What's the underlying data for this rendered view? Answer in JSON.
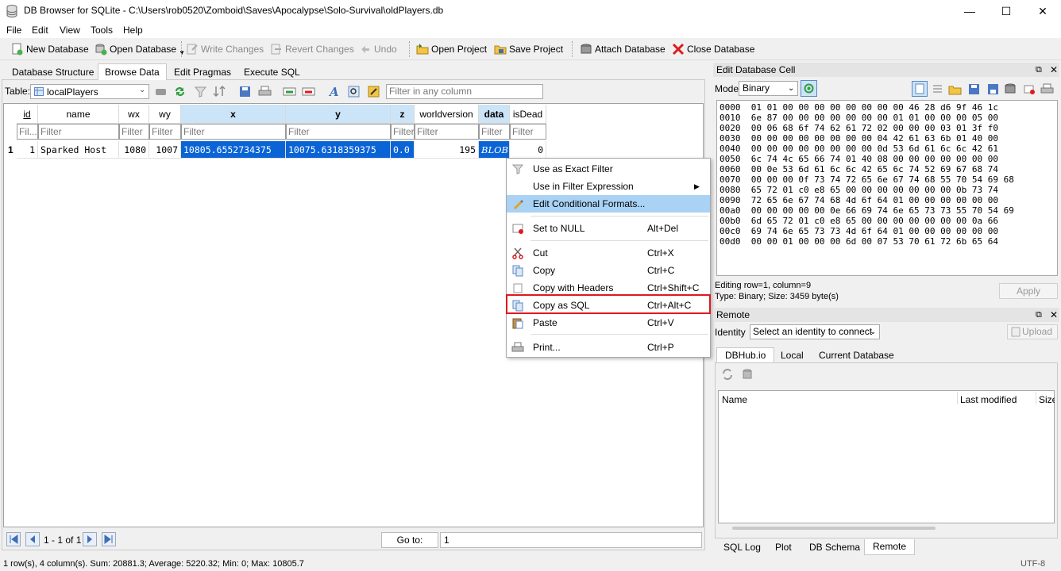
{
  "window": {
    "title": "DB Browser for SQLite - C:\\Users\\rob0520\\Zomboid\\Saves\\Apocalypse\\Solo-Survival\\oldPlayers.db",
    "minimize": "—",
    "maximize": "☐",
    "close": "✕"
  },
  "menu": [
    "File",
    "Edit",
    "View",
    "Tools",
    "Help"
  ],
  "toolbar": {
    "new_database": "New Database",
    "open_database": "Open Database",
    "write_changes": "Write Changes",
    "revert_changes": "Revert Changes",
    "undo": "Undo",
    "open_project": "Open Project",
    "save_project": "Save Project",
    "attach_database": "Attach Database",
    "close_database": "Close Database"
  },
  "left_tabs": [
    "Database Structure",
    "Browse Data",
    "Edit Pragmas",
    "Execute SQL"
  ],
  "browse": {
    "table_label": "Table:",
    "table_value": "localPlayers",
    "filter_any_placeholder": "Filter in any column",
    "columns": [
      "id",
      "name",
      "wx",
      "wy",
      "x",
      "y",
      "z",
      "worldversion",
      "data",
      "isDead"
    ],
    "filter_placeholders": [
      "Fil...",
      "Filter",
      "Filter",
      "Filter",
      "Filter",
      "Filter",
      "Filter",
      "Filter",
      "Filter",
      "Filter"
    ],
    "row_number": "1",
    "row": [
      "1",
      "Sparked Host",
      "1080",
      "1007",
      "10805.6552734375",
      "10075.6318359375",
      "0.0",
      "195",
      "BLOB",
      "0"
    ],
    "pager": "1 - 1 of 1",
    "goto_label": "Go to:",
    "goto_value": "1"
  },
  "context_menu": {
    "use_exact_filter": "Use as Exact Filter",
    "use_filter_expression": "Use in Filter Expression",
    "edit_conditional_formats": "Edit Conditional Formats...",
    "set_null": "Set to NULL",
    "set_null_sc": "Alt+Del",
    "cut": "Cut",
    "cut_sc": "Ctrl+X",
    "copy": "Copy",
    "copy_sc": "Ctrl+C",
    "copy_headers": "Copy with Headers",
    "copy_headers_sc": "Ctrl+Shift+C",
    "copy_sql": "Copy as SQL",
    "copy_sql_sc": "Ctrl+Alt+C",
    "paste": "Paste",
    "paste_sc": "Ctrl+V",
    "print": "Print...",
    "print_sc": "Ctrl+P"
  },
  "edit_cell": {
    "header": "Edit Database Cell",
    "mode_label": "Mode:",
    "mode_value": "Binary",
    "hex_lines": [
      "0000  01 01 00 00 00 00 00 00 00 00 46 28 d6 9f 46 1c",
      "0010  6e 87 00 00 00 00 00 00 00 01 01 00 00 00 05 00",
      "0020  00 06 68 6f 74 62 61 72 02 00 00 00 03 01 3f f0",
      "0030  00 00 00 00 00 00 00 00 04 42 61 63 6b 01 40 00",
      "0040  00 00 00 00 00 00 00 00 0d 53 6d 61 6c 6c 42 61",
      "0050  6c 74 4c 65 66 74 01 40 08 00 00 00 00 00 00 00",
      "0060  00 0e 53 6d 61 6c 6c 42 65 6c 74 52 69 67 68 74",
      "0070  00 00 00 0f 73 74 72 65 6e 67 74 68 55 70 54 69 68",
      "0080  65 72 01 c0 e8 65 00 00 00 00 00 00 00 0b 73 74",
      "0090  72 65 6e 67 74 68 4d 6f 64 01 00 00 00 00 00 00",
      "00a0  00 00 00 00 00 0e 66 69 74 6e 65 73 73 55 70 54 69",
      "00b0  6d 65 72 01 c0 e8 65 00 00 00 00 00 00 00 0a 66",
      "00c0  69 74 6e 65 73 73 4d 6f 64 01 00 00 00 00 00 00",
      "00d0  00 00 01 00 00 00 6d 00 07 53 70 61 72 6b 65 64"
    ],
    "editing_info": "Editing row=1, column=9",
    "type_info": "Type: Binary; Size: 3459 byte(s)",
    "apply": "Apply"
  },
  "remote": {
    "header": "Remote",
    "identity_label": "Identity",
    "identity_value": "Select an identity to connect",
    "upload": "Upload",
    "tabs": [
      "DBHub.io",
      "Local",
      "Current Database"
    ],
    "col_name": "Name",
    "col_modified": "Last modified",
    "col_size": "Size"
  },
  "bottom_tabs": [
    "SQL Log",
    "Plot",
    "DB Schema",
    "Remote"
  ],
  "status": {
    "summary": "1 row(s), 4 column(s). Sum: 20881.3; Average: 5220.32; Min: 0; Max: 10805.7",
    "encoding": "UTF-8"
  }
}
